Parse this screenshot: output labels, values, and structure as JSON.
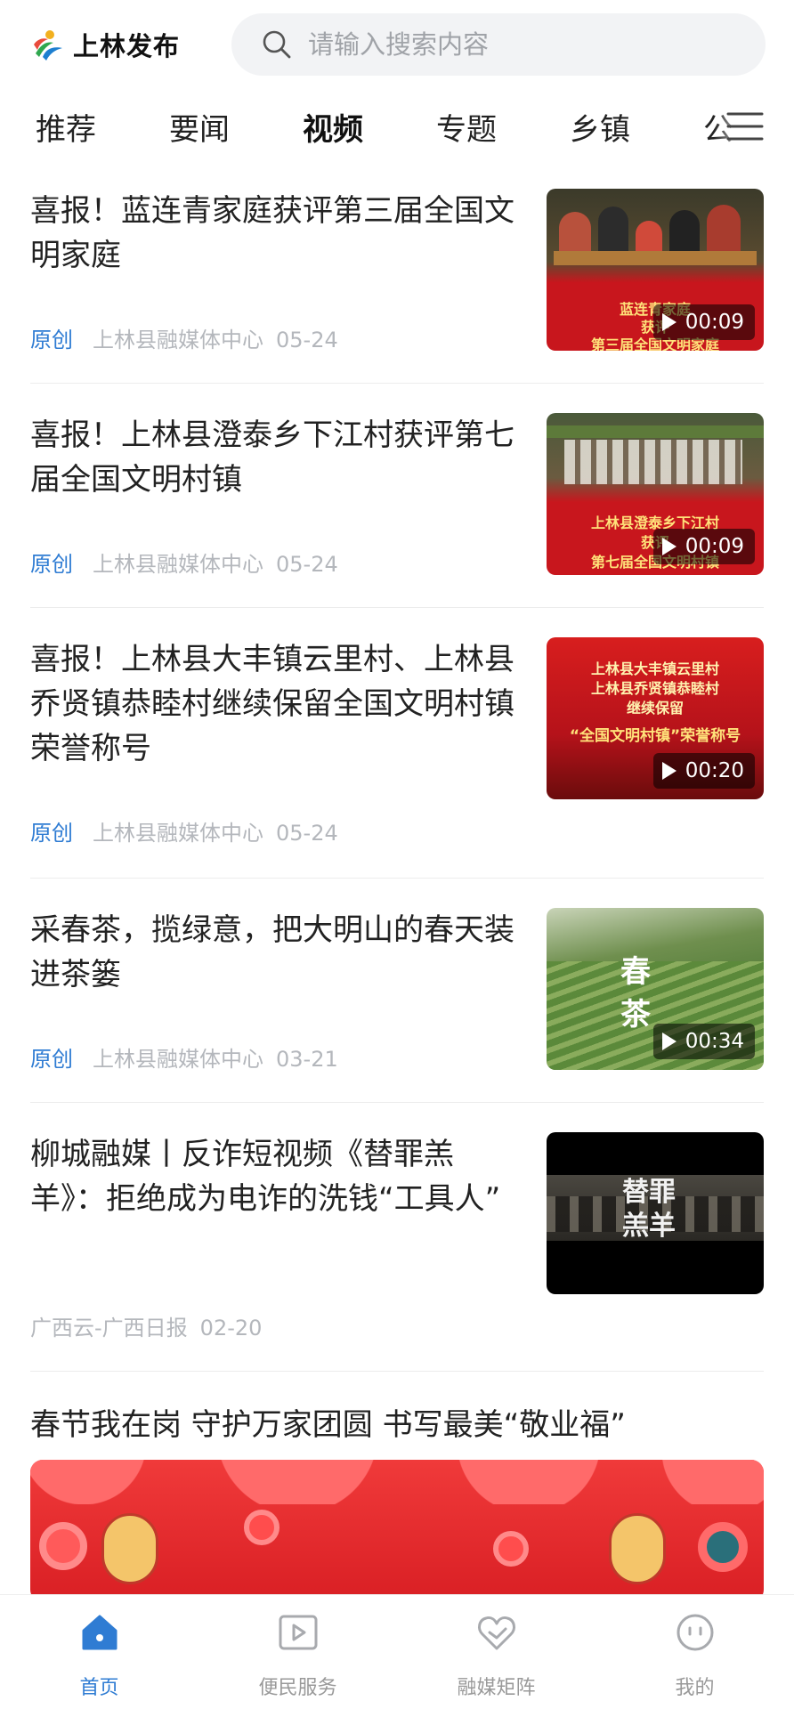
{
  "header": {
    "app_name": "上林发布",
    "search_placeholder": "请输入搜索内容"
  },
  "tabs": [
    {
      "label": "推荐",
      "active": false
    },
    {
      "label": "要闻",
      "active": false
    },
    {
      "label": "视频",
      "active": true
    },
    {
      "label": "专题",
      "active": false
    },
    {
      "label": "乡镇",
      "active": false
    },
    {
      "label": "公",
      "active": false
    }
  ],
  "feed": [
    {
      "title": "喜报！蓝连青家庭获评第三届全国文明家庭",
      "tag": "原创",
      "source": "上林县融媒体中心",
      "date": "05-24",
      "duration": "00:09",
      "thumb_caption": [
        "蓝连青家庭",
        "获评",
        "第三届全国文明家庭"
      ]
    },
    {
      "title": "喜报！上林县澄泰乡下江村获评第七届全国文明村镇",
      "tag": "原创",
      "source": "上林县融媒体中心",
      "date": "05-24",
      "duration": "00:09",
      "thumb_caption": [
        "上林县澄泰乡下江村",
        "获评",
        "第七届全国文明村镇"
      ]
    },
    {
      "title": "喜报！上林县大丰镇云里村、上林县乔贤镇恭睦村继续保留全国文明村镇荣誉称号",
      "tag": "原创",
      "source": "上林县融媒体中心",
      "date": "05-24",
      "duration": "00:20",
      "thumb_caption": [
        "上林县大丰镇云里村",
        "上林县乔贤镇恭睦村",
        "继续保留",
        "“全国文明村镇”荣誉称号"
      ]
    },
    {
      "title": "采春茶，揽绿意，把大明山的春天装进茶篓",
      "tag": "原创",
      "source": "上林县融媒体中心",
      "date": "03-21",
      "duration": "00:34",
      "thumb_caption": [
        "春",
        "茶"
      ]
    },
    {
      "title": "柳城融媒丨反诈短视频《替罪羔羊》：拒绝成为电诈的洗钱“工具人”",
      "tag": "",
      "source": "广西云-广西日报",
      "date": "02-20",
      "duration": "",
      "thumb_caption": [
        "替罪",
        "羔羊"
      ]
    }
  ],
  "feature": {
    "title": "春节我在岗 守护万家团圆 书写最美“敬业福”"
  },
  "bottom_nav": [
    {
      "label": "首页",
      "icon": "home-icon",
      "active": true
    },
    {
      "label": "便民服务",
      "icon": "video-play-icon",
      "active": false
    },
    {
      "label": "融媒矩阵",
      "icon": "heart-icon",
      "active": false
    },
    {
      "label": "我的",
      "icon": "face-icon",
      "active": false
    }
  ],
  "colors": {
    "accent": "#2f7cd3",
    "meta": "#b4b7bc",
    "thumb_red": "#c8161d"
  }
}
